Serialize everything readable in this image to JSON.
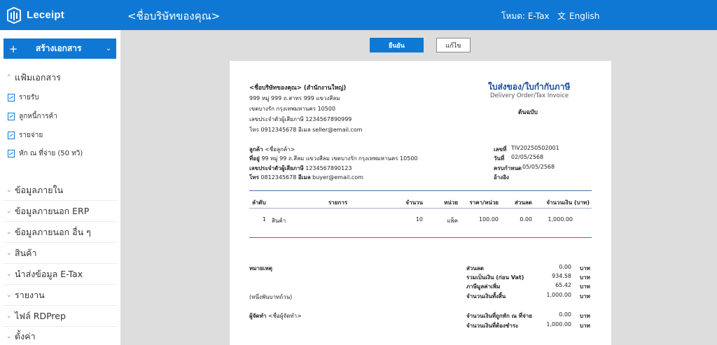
{
  "app": {
    "name": "Leceipt",
    "company_title": "<ชื่อบริษัทของคุณ>",
    "mode": "โหมด: E-Tax",
    "language": "English",
    "accent": "#0f78d4"
  },
  "sidebar": {
    "create_label": "สร้างเอกสาร",
    "docs_section": "แฟ้มเอกสาร",
    "doc_items": [
      "รายรับ",
      "ลูกหนี้การค้า",
      "รายจ่าย",
      "หัก ณ ที่จ่าย (50 ทวิ)"
    ],
    "nav_items": [
      "ข้อมูลภายใน",
      "ข้อมูลภายนอก ERP",
      "ข้อมูลภายนอก อื่น ๆ",
      "สินค้า",
      "นำส่งข้อมูล E-Tax",
      "รายงาน",
      "ไฟล์ RDPrep",
      "ตั้งค่า"
    ]
  },
  "actions": {
    "confirm": "ยืนยัน",
    "edit": "แก้ไข"
  },
  "document": {
    "seller_name": "<ชื่อบริษัทของคุณ> (สำนักงานใหญ่)",
    "seller_addr1": "999 หมู่ 999 ถ.สาทร 999 แขวงสีลม",
    "seller_addr2": "เขตบางรัก กรุงเทพมหานคร 10500",
    "seller_tax": "เลขประจำตัวผู้เสียภาษี 1234567890999",
    "seller_phone_label": "โทร",
    "seller_phone": "0912345678",
    "seller_email_label": "อีเมล",
    "seller_email": "seller@email.com",
    "title_th": "ใบส่งของ/ใบกำกับภาษี",
    "title_en": "Delivery Order/Tax Invoice",
    "copy_type": "ต้นฉบับ",
    "customer_label": "ลูกค้า",
    "customer_name": "<ชื่อลูกค้า>",
    "address_label": "ที่อยู่",
    "customer_address": "99 หมู่ 99 ถ.สีลม แขวงสีลม เขตบางรัก กรุงเทพมหานคร 10500",
    "customer_tax_label": "เลขประจำตัวผู้เสียภาษี",
    "customer_tax": "1234567890123",
    "customer_phone_label": "โทร",
    "customer_phone": "0812345678",
    "customer_email_label": "อีเมล",
    "customer_email": "buyer@email.com",
    "number_label": "เลขที่",
    "number": "TIV20250502001",
    "date_label": "วันที่",
    "date": "02/05/2568",
    "due_label": "ครบกำหนด",
    "due": "05/05/2568",
    "ref_label": "อ้างอิง",
    "columns": [
      "ลำดับ",
      "รายการ",
      "จำนวน",
      "หน่วย",
      "ราคา/หน่วย",
      "ส่วนลด",
      "จำนวนเงิน (บาท)"
    ],
    "rows": [
      {
        "no": "1",
        "item": "สินค้า",
        "qty": "10",
        "unit": "แพ็ค",
        "price": "100.00",
        "discount": "0.00",
        "amount": "1,000.00"
      }
    ],
    "note_label": "หมายเหตุ",
    "amount_words": "(หนึ่งพันบาทถ้วน)",
    "issuer_label": "ผู้จัดทำ",
    "issuer_name": "<ชื่อผู้จัดทำ>",
    "currency": "บาท",
    "totals": [
      {
        "label": "ส่วนลด",
        "value": "0.00"
      },
      {
        "label": "รวมเป็นเงิน (ก่อน Vat)",
        "value": "934.58"
      },
      {
        "label": "ภาษีมูลค่าเพิ่ม",
        "value": "65.42"
      },
      {
        "label": "จำนวนเงินทั้งสิ้น",
        "value": "1,000.00"
      }
    ],
    "withholding": [
      {
        "label": "จำนวนเงินที่ถูกหัก ณ ที่จ่าย",
        "value": "0.00"
      },
      {
        "label": "จำนวนเงินที่ต้องชำระ",
        "value": "1,000.00"
      }
    ]
  }
}
